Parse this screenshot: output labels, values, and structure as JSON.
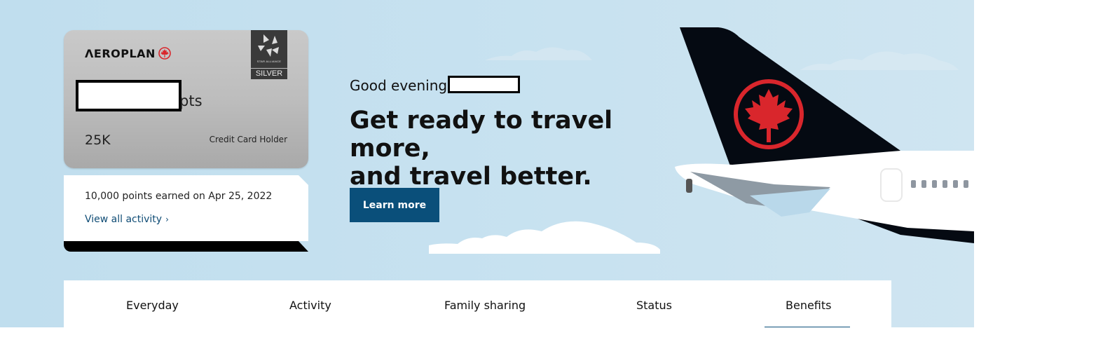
{
  "card": {
    "brand": "ΛEROPLAN",
    "alliance_text": "STAR ALLIANCE",
    "tier": "SILVER",
    "points_suffix": "pts",
    "points_value": "25K",
    "holder_label": "Credit Card Holder"
  },
  "activity": {
    "earned_text": "10,000 points earned on Apr 25, 2022",
    "link_label": "View all activity",
    "link_chevron": "›"
  },
  "hero": {
    "greeting": "Good evening,",
    "headline_line1": "Get ready to travel more,",
    "headline_line2": "and travel better.",
    "cta_label": "Learn more"
  },
  "tabs": [
    {
      "label": "Everyday"
    },
    {
      "label": "Activity"
    },
    {
      "label": "Family sharing"
    },
    {
      "label": "Status"
    },
    {
      "label": "Benefits",
      "active": true
    }
  ],
  "colors": {
    "hero_bg": "#c2dfef",
    "accent": "#0a4f7a",
    "maple_red": "#d9262c",
    "tail_black": "#050a12"
  },
  "icons": [
    "maple-leaf-icon",
    "star-alliance-icon",
    "chevron-right-icon"
  ]
}
